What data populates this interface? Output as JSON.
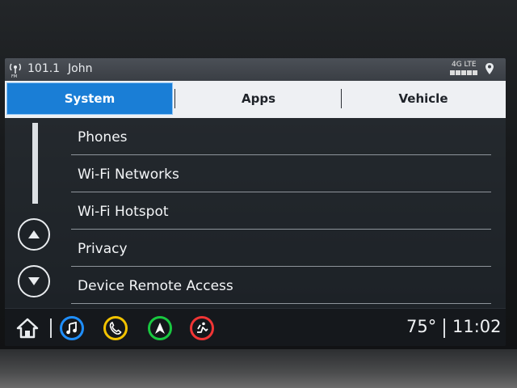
{
  "status_bar": {
    "radio_frequency": "101.1",
    "radio_station_name": "John",
    "network_label": "4G LTE",
    "icons": {
      "radio": "fm-radio-icon",
      "location": "location-pin-icon"
    }
  },
  "tabs": [
    {
      "label": "System",
      "active": true
    },
    {
      "label": "Apps",
      "active": false
    },
    {
      "label": "Vehicle",
      "active": false
    }
  ],
  "menu_items": [
    {
      "label": "Phones"
    },
    {
      "label": "Wi-Fi Networks"
    },
    {
      "label": "Wi-Fi Hotspot"
    },
    {
      "label": "Privacy"
    },
    {
      "label": "Device Remote Access"
    }
  ],
  "scroll": {
    "up_icon": "up-arrow-icon",
    "down_icon": "down-arrow-icon"
  },
  "bottom_bar": {
    "temperature": "75°",
    "time": "11:02",
    "apps": [
      {
        "name": "music-icon",
        "color": "#1f8fff"
      },
      {
        "name": "phone-icon",
        "color": "#f2c300"
      },
      {
        "name": "navigation-icon",
        "color": "#19c840"
      },
      {
        "name": "vehicle-icon",
        "color": "#f03535"
      }
    ]
  },
  "colors": {
    "accent": "#1a7ed6",
    "tab_bar": "#eef0f3",
    "screen_bg": "#1d2227"
  }
}
